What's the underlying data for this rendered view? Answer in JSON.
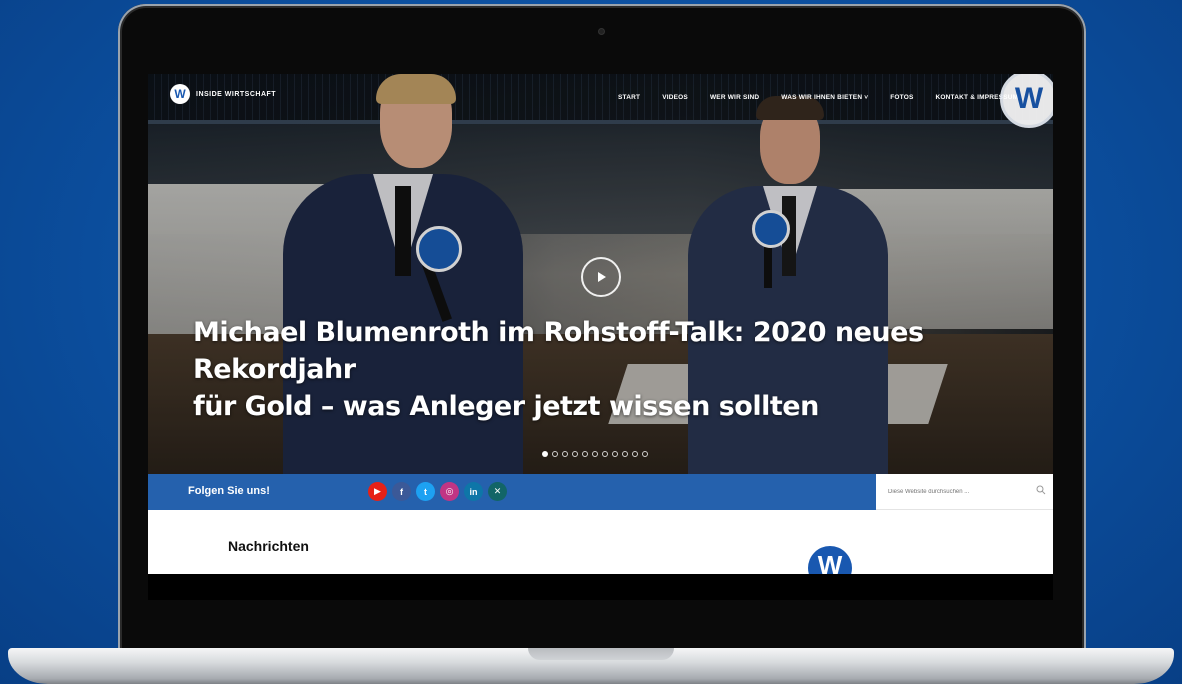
{
  "site": {
    "logo_text": "INSIDE WIRTSCHAFT",
    "logo_letter": "W"
  },
  "nav": {
    "items": [
      {
        "label": "START"
      },
      {
        "label": "VIDEOS"
      },
      {
        "label": "WER WIR SIND"
      },
      {
        "label": "WAS WIR IHNEN BIETEN ˅"
      },
      {
        "label": "FOTOS"
      },
      {
        "label": "KONTAKT & IMPRESSUM"
      }
    ]
  },
  "hero": {
    "headline_line1": "Michael Blumenroth im Rohstoff-Talk: 2020 neues Rekordjahr",
    "headline_line2": "für Gold – was Anleger jetzt wissen sollten",
    "slide_count": 11,
    "active_slide": 1
  },
  "social": {
    "follow_label": "Folgen Sie uns!",
    "icons": [
      {
        "name": "youtube-icon",
        "glyph": "▶",
        "color": "#e62117"
      },
      {
        "name": "facebook-icon",
        "glyph": "f",
        "color": "#3b5998"
      },
      {
        "name": "twitter-icon",
        "glyph": "t",
        "color": "#1da1f2"
      },
      {
        "name": "instagram-icon",
        "glyph": "◎",
        "color": "#c13584"
      },
      {
        "name": "linkedin-icon",
        "glyph": "in",
        "color": "#0e76a8"
      },
      {
        "name": "xing-icon",
        "glyph": "✕",
        "color": "#126567"
      }
    ]
  },
  "search": {
    "placeholder": "Diese Website durchsuchen ..."
  },
  "content": {
    "section_title": "Nachrichten"
  },
  "colors": {
    "brand_blue": "#2561ad",
    "background_blue": "#0b4d9c"
  }
}
